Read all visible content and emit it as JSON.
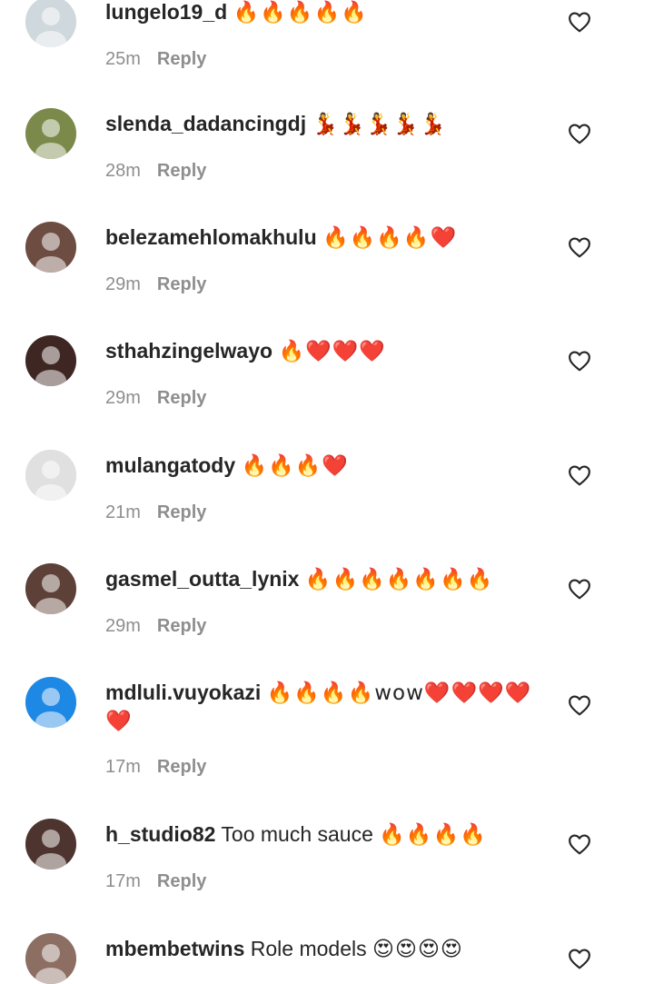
{
  "comments": [
    {
      "username": "lungelo19_d",
      "text": "",
      "emoji": "🔥🔥🔥🔥🔥",
      "time": "25m",
      "reply": "Reply",
      "avatar_color": "#cfd8dc"
    },
    {
      "username": "slenda_dadancingdj",
      "text": "",
      "emoji": "💃💃💃💃💃",
      "time": "28m",
      "reply": "Reply",
      "avatar_color": "#7b8a4a"
    },
    {
      "username": "belezamehlomakhulu",
      "text": "",
      "emoji": "🔥🔥🔥🔥❤️",
      "time": "29m",
      "reply": "Reply",
      "avatar_color": "#6d4c41"
    },
    {
      "username": "sthahzingelwayo",
      "text": "",
      "emoji": "🔥❤️❤️❤️",
      "time": "29m",
      "reply": "Reply",
      "avatar_color": "#3e2723"
    },
    {
      "username": "mulangatody",
      "text": "",
      "emoji": "🔥🔥🔥❤️",
      "time": "21m",
      "reply": "Reply",
      "avatar_color": "#e0e0e0"
    },
    {
      "username": "gasmel_outta_lynix",
      "text": "",
      "emoji": "🔥🔥🔥🔥🔥🔥🔥",
      "time": "29m",
      "reply": "Reply",
      "avatar_color": "#5d4037"
    },
    {
      "username": "mdluli.vuyokazi",
      "text": "",
      "emoji": "🔥🔥🔥🔥wow❤️❤️❤️❤️❤️",
      "time": "17m",
      "reply": "Reply",
      "avatar_color": "#1e88e5"
    },
    {
      "username": "h_studio82",
      "text": "Too much sauce",
      "emoji": "🔥🔥🔥🔥",
      "time": "17m",
      "reply": "Reply",
      "avatar_color": "#4e342e"
    },
    {
      "username": "mbembetwins",
      "text": "Role models",
      "emoji": "😍😍😍😍",
      "time": "",
      "reply": "",
      "avatar_color": "#8d6e63"
    }
  ]
}
